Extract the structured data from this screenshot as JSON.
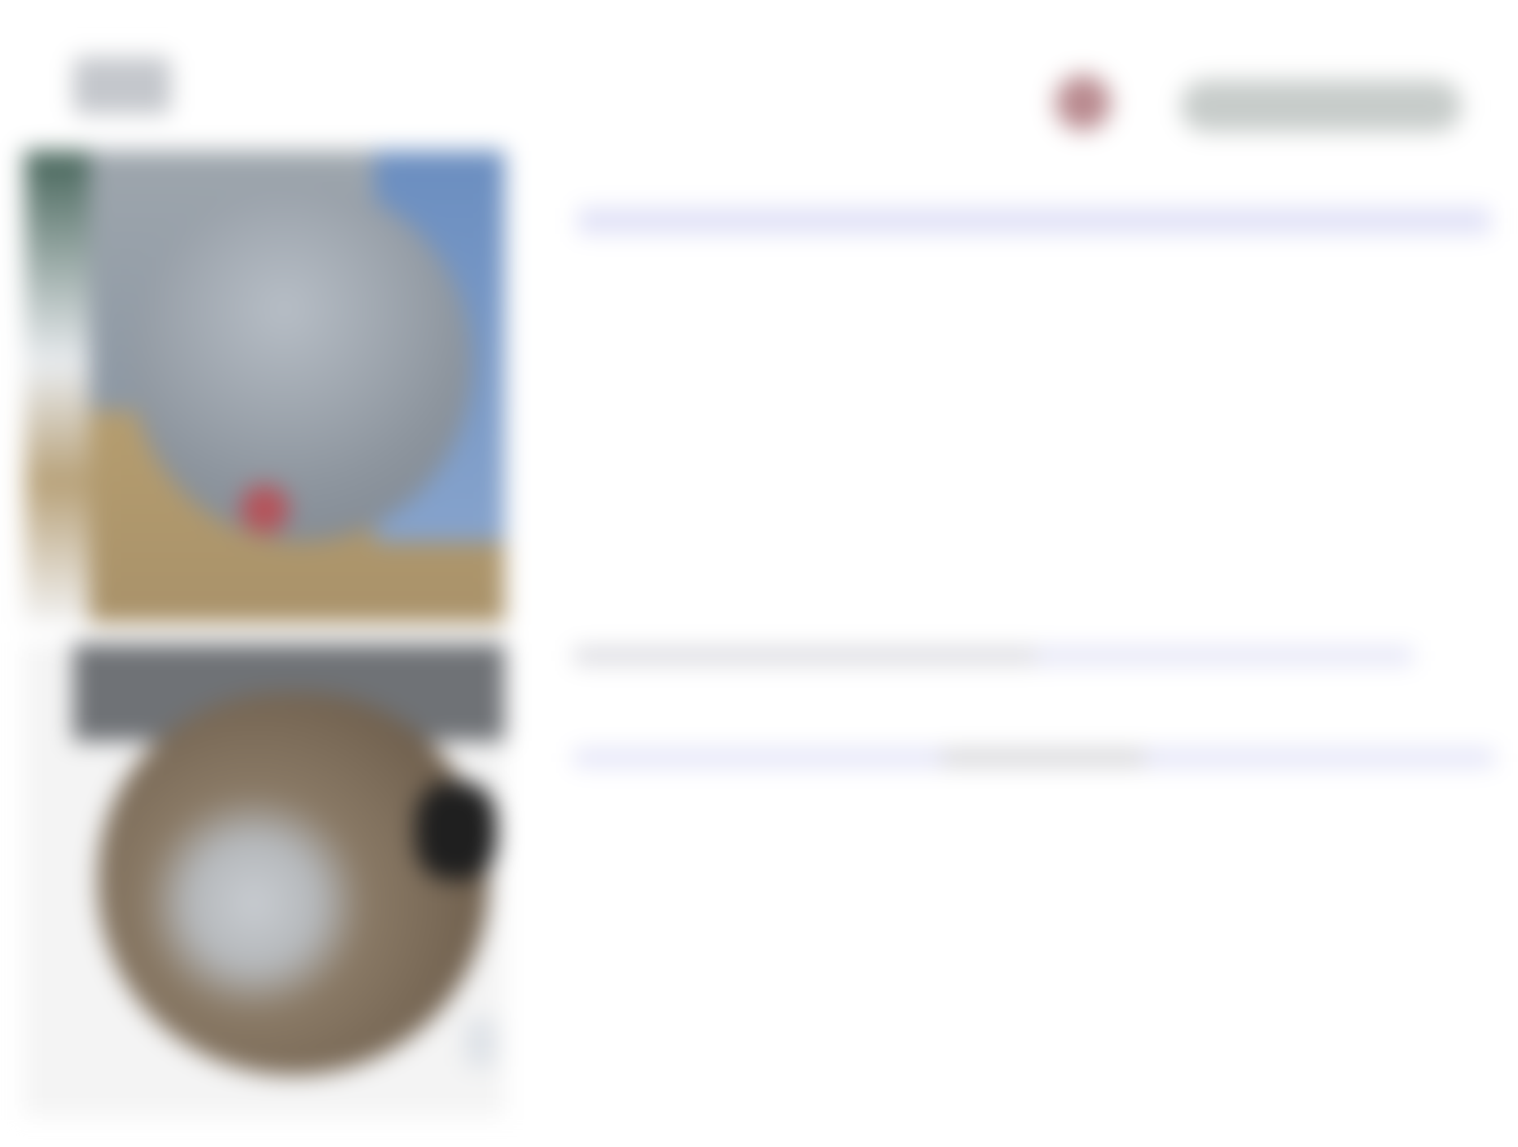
{
  "header": {
    "site_title": "",
    "action_button_label": ""
  },
  "listings": [
    {
      "title_line_1": "",
      "thumbnail_icon": "balloon-photo"
    },
    {
      "title_line_1": "",
      "title_line_2": "",
      "thumbnail_icon": "animal-photo"
    }
  ],
  "footer": {
    "label": ""
  },
  "colors": {
    "link": "#5c63d6",
    "link_background": "#e0e1f7",
    "avatar": "#b98a8f",
    "button": "#c7ccca"
  }
}
